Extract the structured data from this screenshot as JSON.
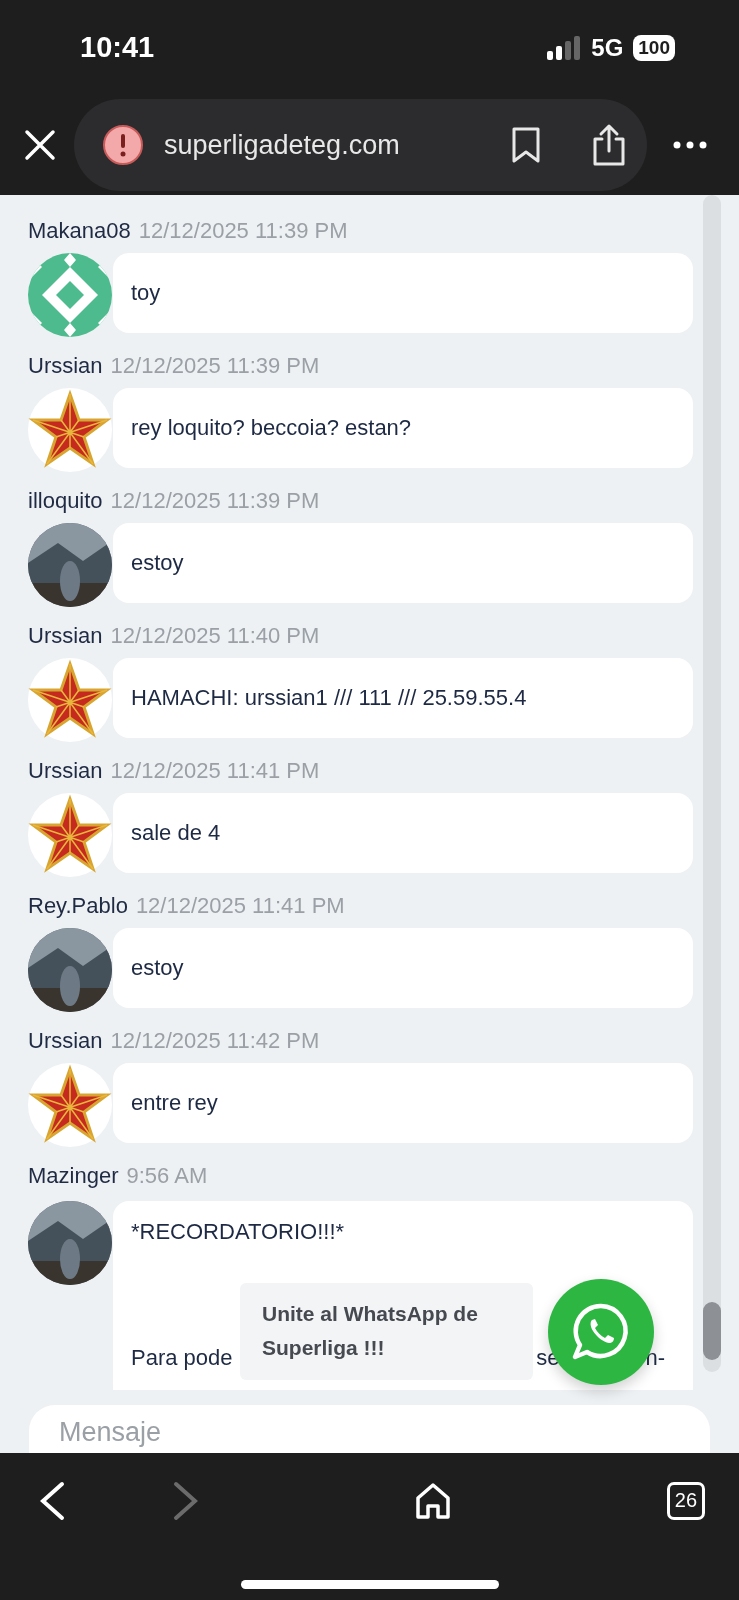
{
  "status_bar": {
    "time": "10:41",
    "network": "5G",
    "battery": "100"
  },
  "browser": {
    "url": "superligadeteg.com",
    "tab_count": "26",
    "back_disabled": false,
    "forward_disabled": true
  },
  "messages": [
    {
      "user": "Makana08",
      "time": "12/12/2025 11:39 PM",
      "kind": "pattern",
      "text": "toy"
    },
    {
      "user": "Urssian",
      "time": "12/12/2025 11:39 PM",
      "kind": "star",
      "text": "rey loquito? beccoia? estan?"
    },
    {
      "user": "illoquito",
      "time": "12/12/2025 11:39 PM",
      "kind": "picture",
      "text": "estoy"
    },
    {
      "user": "Urssian",
      "time": "12/12/2025 11:40 PM",
      "kind": "star",
      "text": "HAMACHI: urssian1 /// 111 /// 25.59.55.4"
    },
    {
      "user": "Urssian",
      "time": "12/12/2025 11:41 PM",
      "kind": "star",
      "text": "sale de 4"
    },
    {
      "user": "Rey.Pablo",
      "time": "12/12/2025 11:41 PM",
      "kind": "picture",
      "text": "estoy"
    },
    {
      "user": "Urssian",
      "time": "12/12/2025 11:42 PM",
      "kind": "star",
      "text": "entre rey"
    },
    {
      "user": "Mazinger",
      "time": "9:56 AM",
      "kind": "picture",
      "text": "*RECORDATORIO!!!*",
      "partial_line": [
        "Para pode",
        "se",
        "n-"
      ]
    }
  ],
  "composer": {
    "placeholder": "Mensaje"
  },
  "whatsapp_popup": {
    "text": "Unite al WhatsApp de Superliga !!!"
  }
}
